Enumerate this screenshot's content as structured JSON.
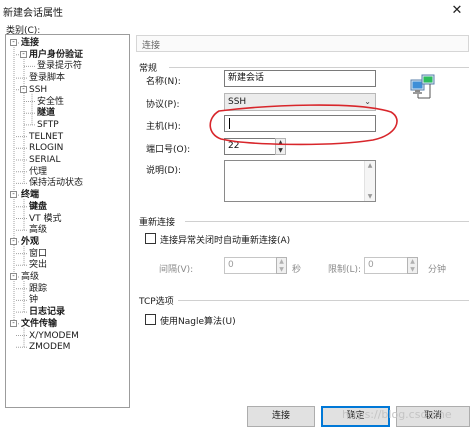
{
  "window": {
    "title": "新建会话属性",
    "close_glyph": "✕"
  },
  "category_label": "类别(C):",
  "tree": {
    "items": [
      {
        "label": "连接",
        "level": 0,
        "expand": "-",
        "bold": true
      },
      {
        "label": "用户身份验证",
        "level": 1,
        "expand": "-",
        "bold": true
      },
      {
        "label": "登录提示符",
        "level": 2,
        "expand": "",
        "bold": false
      },
      {
        "label": "登录脚本",
        "level": 1,
        "expand": "",
        "bold": false
      },
      {
        "label": "SSH",
        "level": 1,
        "expand": "-",
        "bold": false
      },
      {
        "label": "安全性",
        "level": 2,
        "expand": "",
        "bold": false
      },
      {
        "label": "隧道",
        "level": 2,
        "expand": "",
        "bold": true
      },
      {
        "label": "SFTP",
        "level": 2,
        "expand": "",
        "bold": false
      },
      {
        "label": "TELNET",
        "level": 1,
        "expand": "",
        "bold": false
      },
      {
        "label": "RLOGIN",
        "level": 1,
        "expand": "",
        "bold": false
      },
      {
        "label": "SERIAL",
        "level": 1,
        "expand": "",
        "bold": false
      },
      {
        "label": "代理",
        "level": 1,
        "expand": "",
        "bold": false
      },
      {
        "label": "保持活动状态",
        "level": 1,
        "expand": "",
        "bold": false
      },
      {
        "label": "终端",
        "level": 0,
        "expand": "-",
        "bold": true
      },
      {
        "label": "键盘",
        "level": 1,
        "expand": "",
        "bold": true
      },
      {
        "label": "VT 模式",
        "level": 1,
        "expand": "",
        "bold": false
      },
      {
        "label": "高级",
        "level": 1,
        "expand": "",
        "bold": false
      },
      {
        "label": "外观",
        "level": 0,
        "expand": "-",
        "bold": true
      },
      {
        "label": "窗口",
        "level": 1,
        "expand": "",
        "bold": false
      },
      {
        "label": "突出",
        "level": 1,
        "expand": "",
        "bold": false
      },
      {
        "label": "高级",
        "level": 0,
        "expand": "-",
        "bold": false
      },
      {
        "label": "跟踪",
        "level": 1,
        "expand": "",
        "bold": false
      },
      {
        "label": "钟",
        "level": 1,
        "expand": "",
        "bold": false
      },
      {
        "label": "日志记录",
        "level": 1,
        "expand": "",
        "bold": true
      },
      {
        "label": "文件传输",
        "level": 0,
        "expand": "-",
        "bold": true
      },
      {
        "label": "X/YMODEM",
        "level": 1,
        "expand": "",
        "bold": false
      },
      {
        "label": "ZMODEM",
        "level": 1,
        "expand": "",
        "bold": false
      }
    ]
  },
  "panel": {
    "header": "连接",
    "general": {
      "title": "常规",
      "name_label": "名称(N):",
      "name_value": "新建会话",
      "protocol_label": "协议(P):",
      "protocol_value": "SSH",
      "host_label": "主机(H):",
      "host_value": "",
      "port_label": "端口号(O):",
      "port_value": "22",
      "desc_label": "说明(D):",
      "desc_value": ""
    },
    "reconnect": {
      "title": "重新连接",
      "checkbox_label": "连接异常关闭时自动重新连接(A)",
      "interval_label": "间隔(V):",
      "interval_value": "0",
      "interval_unit": "秒",
      "limit_label": "限制(L):",
      "limit_value": "0",
      "limit_unit": "分钟"
    },
    "tcp": {
      "title": "TCP选项",
      "checkbox_label": "使用Nagle算法(U)"
    }
  },
  "buttons": {
    "connect": "连接",
    "ok": "确定",
    "cancel": "取消"
  },
  "watermark": "https://blog.csdn.ne",
  "colors": {
    "highlight_ellipse": "#d8262b",
    "default_button_border": "#0078d7"
  }
}
